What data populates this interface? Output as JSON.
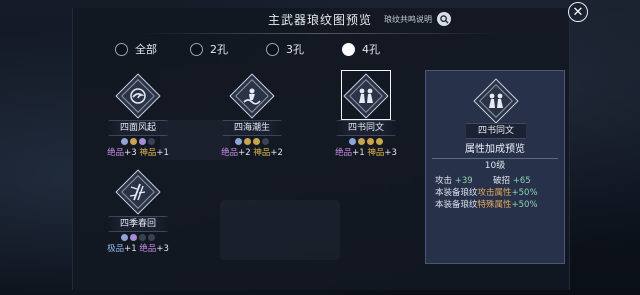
{
  "header": {
    "title": "主武器琅纹图预览",
    "help_label": "琅纹共鸣说明"
  },
  "filters": [
    {
      "label": "全部",
      "selected": false
    },
    {
      "label": "2孔",
      "selected": false
    },
    {
      "label": "3孔",
      "selected": false
    },
    {
      "label": "4孔",
      "selected": true
    }
  ],
  "patterns": [
    {
      "name": "四面风起",
      "icon": "wind-swirl-icon",
      "gems": [
        "blue",
        "gold",
        "purple",
        "empty"
      ],
      "grade_a": "绝品",
      "count_a": "+3",
      "grade_b": "神品",
      "count_b": "+1"
    },
    {
      "name": "四海潮生",
      "icon": "wave-rider-icon",
      "gems": [
        "blue",
        "gold",
        "gold",
        "empty"
      ],
      "grade_a": "绝品",
      "count_a": "+2",
      "grade_b": "神品",
      "count_b": "+2"
    },
    {
      "name": "四书同文",
      "icon": "twin-figures-icon",
      "gems": [
        "blue",
        "gold",
        "gold",
        "gold"
      ],
      "grade_a": "绝品",
      "count_a": "+1",
      "grade_b": "神品",
      "count_b": "+3",
      "selected": true
    },
    {
      "name": "四季春回",
      "icon": "bamboo-icon",
      "gems": [
        "blue",
        "purple",
        "empty",
        "empty"
      ],
      "grade_a": "极品",
      "count_a": "+1",
      "grade_b": "绝品",
      "count_b": "+3"
    }
  ],
  "preview": {
    "name": "四书同文",
    "heading": "属性加成预览",
    "level": "10级",
    "stat1_label": "攻击",
    "stat1_value": "+39",
    "stat2_label": "破招",
    "stat2_value": "+65",
    "line3_prefix": "本装备琅纹",
    "line3_attr": "攻击属性",
    "line3_value": "+50%",
    "line4_prefix": "本装备琅纹",
    "line4_attr": "特殊属性",
    "line4_value": "+50%"
  },
  "colors": {
    "accent_purple": "#c68ae8",
    "accent_gold": "#e0b64c",
    "accent_green": "#8fd0b0",
    "accent_orange": "#e3a85a"
  }
}
